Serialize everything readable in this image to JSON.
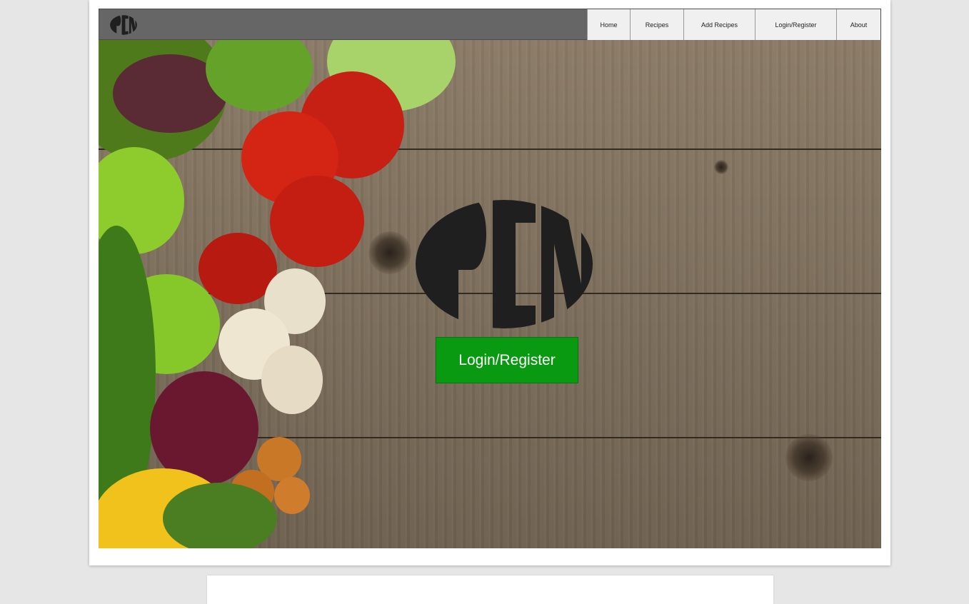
{
  "nav": {
    "items": [
      {
        "label": "Home"
      },
      {
        "label": "Recipes"
      },
      {
        "label": "Add Recipes"
      },
      {
        "label": "Login/Register"
      },
      {
        "label": "About"
      }
    ]
  },
  "hero": {
    "cta_label": "Login/Register"
  },
  "colors": {
    "navbar": "#666666",
    "cta": "#0a9a12",
    "page_bg": "#e6e6e6"
  },
  "icons": {
    "logo": "pcn-monogram-logo"
  }
}
